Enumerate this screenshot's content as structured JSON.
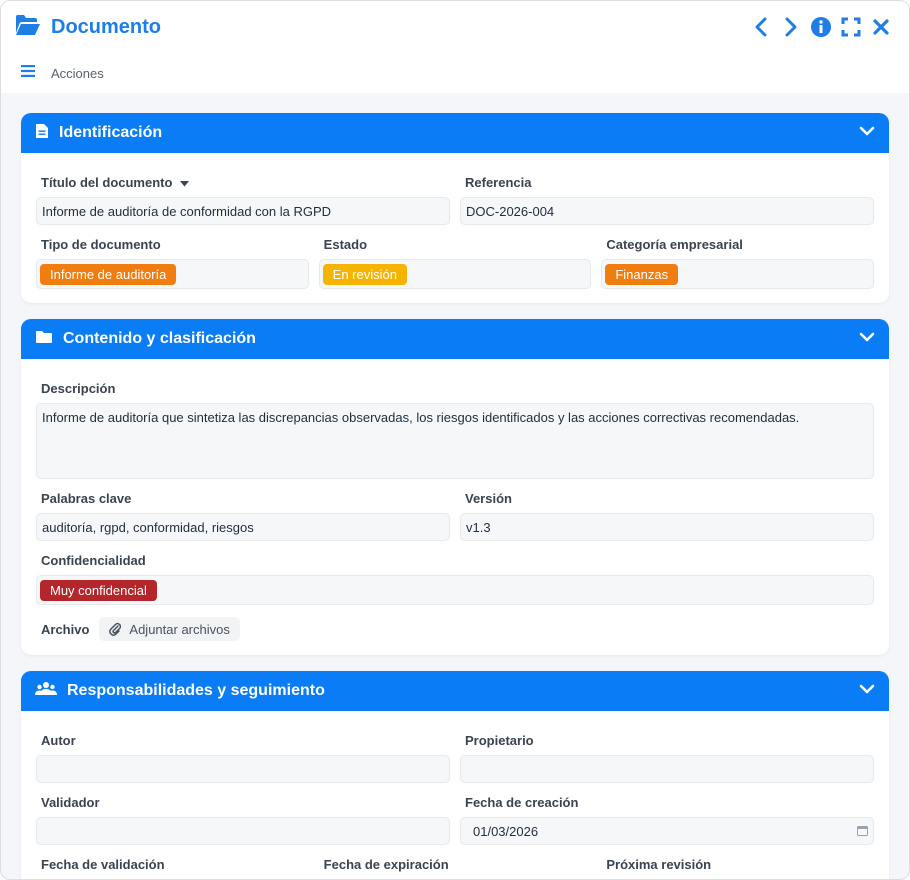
{
  "window": {
    "title": "Documento"
  },
  "toolbar": {
    "actions_label": "Acciones"
  },
  "sections": {
    "ident": {
      "title": "Identificación",
      "titulo_label": "Título del documento",
      "titulo_value": "Informe de auditoría de conformidad con la RGPD",
      "ref_label": "Referencia",
      "ref_value": "DOC-2026-004",
      "tipo_label": "Tipo de documento",
      "tipo_value": "Informe de auditoría",
      "estado_label": "Estado",
      "estado_value": "En revisión",
      "cat_label": "Categoría empresarial",
      "cat_value": "Finanzas"
    },
    "contenido": {
      "title": "Contenido y clasificación",
      "desc_label": "Descripción",
      "desc_value": "Informe de auditoría que sintetiza las discrepancias observadas, los riesgos identificados y las acciones correctivas recomendadas.",
      "kw_label": "Palabras clave",
      "kw_value": "auditoría, rgpd, conformidad, riesgos",
      "ver_label": "Versión",
      "ver_value": "v1.3",
      "conf_label": "Confidencialidad",
      "conf_value": "Muy confidencial",
      "archivo_label": "Archivo",
      "attach_label": "Adjuntar archivos"
    },
    "resp": {
      "title": "Responsabilidades y seguimiento",
      "autor_label": "Autor",
      "autor_value": "",
      "prop_label": "Propietario",
      "prop_value": "",
      "valid_label": "Validador",
      "valid_value": "",
      "fecha_label": "Fecha de creación",
      "fecha_value": "01/03/2026",
      "fval_label": "Fecha de validación",
      "fexp_label": "Fecha de expiración",
      "prox_label": "Próxima revisión"
    }
  },
  "colors": {
    "accent": "#0a7cf5",
    "badge_orange": "#f07d10",
    "badge_yellow": "#f5b400",
    "badge_red": "#b3262b"
  },
  "icons": {
    "title": "folder-open-icon",
    "ident": "file-text-icon",
    "contenido": "folder-icon",
    "resp": "users-icon"
  }
}
